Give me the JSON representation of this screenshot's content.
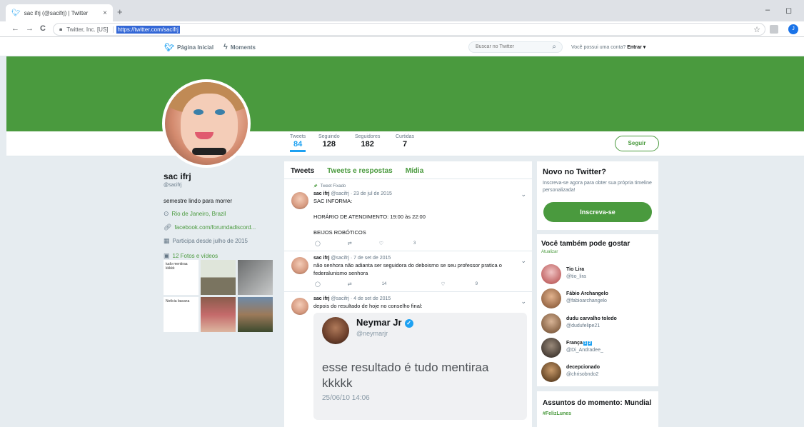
{
  "browser": {
    "tab_title": "sac ifrj (@sacifrj) | Twitter",
    "tab_close": "×",
    "new_tab": "+",
    "minimize": "–",
    "restore": "◻",
    "back": "←",
    "forward": "→",
    "reload": "C",
    "site_name": "Twitter, Inc. [US]",
    "url": "https://twitter.com/sacifrj",
    "profile_initial": "J"
  },
  "topnav": {
    "home_label": "Página Inicial",
    "moments_label": "Moments",
    "search_placeholder": "Buscar no Twitter",
    "login_prompt": "Você possui uma conta?",
    "login_label": "Entrar ▾"
  },
  "profile": {
    "name": "sac ifrj",
    "handle": "@sacifrj",
    "bio": "semestre lindo para morrer",
    "location": "Rio de Janeiro, Brazil",
    "website": "facebook.com/forumdadiscord...",
    "joined": "Participa desde julho de 2015",
    "photos_link": "12 Fotos e vídeos",
    "follow_label": "Seguir"
  },
  "stats": [
    {
      "label": "Tweets",
      "value": "84"
    },
    {
      "label": "Seguindo",
      "value": "128"
    },
    {
      "label": "Seguidores",
      "value": "182"
    },
    {
      "label": "Curtidas",
      "value": "7"
    }
  ],
  "media_grid": {
    "cell1_text": "tudo mentiraa kkkkk",
    "cell4_text": "Notícia bacana"
  },
  "timeline": {
    "tabs": [
      "Tweets",
      "Tweets e respostas",
      "Mídia"
    ],
    "pinned_label": "Tweet Fixado",
    "tweets": [
      {
        "name": "sac ifrj",
        "meta": "@sacifrj · 23 de jul de 2015",
        "text": "SAC INFORMA:\n\nHORÁRIO DE ATENDIMENTO: 19:00 às 22:00\n\nBEIJOS ROBÓTICOS",
        "retweets": "",
        "likes": "3"
      },
      {
        "name": "sac ifrj",
        "meta": "@sacifrj · 7 de set de 2015",
        "text": "não senhora não adianta ser seguidora do deboismo se seu professor pratica o federalunismo senhora",
        "retweets": "14",
        "likes": "9"
      },
      {
        "name": "sac ifrj",
        "meta": "@sacifrj · 4 de set de 2015",
        "text": "depois do resultado de hoje no conselho final:"
      }
    ],
    "embed": {
      "name": "Neymar Jr",
      "handle": "@neymarjr",
      "text": "esse resultado é tudo mentiraa kkkkk",
      "date": "25/06/10 14:06"
    }
  },
  "sidebar": {
    "signup": {
      "title": "Novo no Twitter?",
      "desc": "Inscreva-se agora para obter sua própria timeline personalizada!",
      "button": "Inscreva-se"
    },
    "suggestions_title": "Você também pode gostar",
    "refresh_label": "Atualizar",
    "suggestions": [
      {
        "name": "Tio Lira",
        "handle": "@tio_lira"
      },
      {
        "name": "Fábio Archangelo",
        "handle": "@fabioarchangelo"
      },
      {
        "name": "dudu carvalho toledo",
        "handle": "@dudufelipe21"
      },
      {
        "name": "França",
        "handle": "@Di_Andradee_"
      },
      {
        "name": "decepcionado",
        "handle": "@chrisobndo2"
      }
    ],
    "trends_title": "Assuntos do momento: Mundial",
    "first_trend": "#FelizLunes"
  },
  "colors": {
    "accent": "#4a9a3e",
    "twitter_blue": "#1da1f2"
  }
}
